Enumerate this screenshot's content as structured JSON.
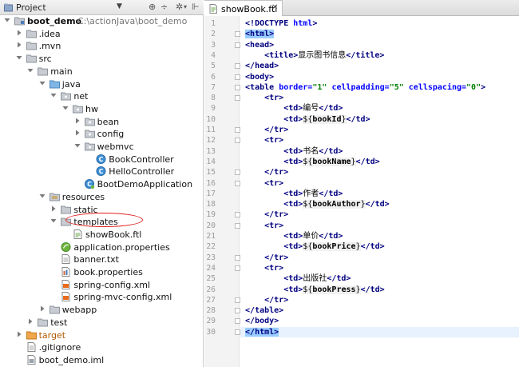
{
  "project_panel": {
    "title": "Project",
    "tree": [
      {
        "label": "boot_demo",
        "path": "C:\\actionJava\\boot_demo",
        "icon": "folder-module-icon",
        "level": 0,
        "expanded": true,
        "bold": true
      },
      {
        "label": ".idea",
        "icon": "folder-icon",
        "level": 1,
        "expanded": false
      },
      {
        "label": ".mvn",
        "icon": "folder-icon",
        "level": 1,
        "expanded": false
      },
      {
        "label": "src",
        "icon": "folder-icon",
        "level": 1,
        "expanded": true
      },
      {
        "label": "main",
        "icon": "folder-icon",
        "level": 2,
        "expanded": true
      },
      {
        "label": "java",
        "icon": "source-folder-icon",
        "level": 3,
        "expanded": true
      },
      {
        "label": "net",
        "icon": "package-icon",
        "level": 4,
        "expanded": true
      },
      {
        "label": "hw",
        "icon": "package-icon",
        "level": 5,
        "expanded": true
      },
      {
        "label": "bean",
        "icon": "package-icon",
        "level": 6,
        "expanded": false
      },
      {
        "label": "config",
        "icon": "package-icon",
        "level": 6,
        "expanded": false
      },
      {
        "label": "webmvc",
        "icon": "package-icon",
        "level": 6,
        "expanded": true
      },
      {
        "label": "BookController",
        "icon": "class-icon",
        "level": 7
      },
      {
        "label": "HelloController",
        "icon": "class-icon",
        "level": 7
      },
      {
        "label": "BootDemoApplication",
        "icon": "spring-boot-class-icon",
        "level": 6
      },
      {
        "label": "resources",
        "icon": "resources-folder-icon",
        "level": 3,
        "expanded": true
      },
      {
        "label": "static",
        "icon": "folder-icon",
        "level": 4,
        "expanded": false
      },
      {
        "label": "templates",
        "icon": "folder-icon",
        "level": 4,
        "expanded": true
      },
      {
        "label": "showBook.ftl",
        "icon": "ftl-file-icon",
        "level": 5
      },
      {
        "label": "application.properties",
        "icon": "spring-properties-icon",
        "level": 4
      },
      {
        "label": "banner.txt",
        "icon": "text-file-icon",
        "level": 4
      },
      {
        "label": "book.properties",
        "icon": "properties-file-icon",
        "level": 4
      },
      {
        "label": "spring-config.xml",
        "icon": "xml-file-icon",
        "level": 4
      },
      {
        "label": "spring-mvc-config.xml",
        "icon": "xml-file-icon",
        "level": 4
      },
      {
        "label": "webapp",
        "icon": "folder-icon",
        "level": 3,
        "expanded": false
      },
      {
        "label": "test",
        "icon": "folder-icon",
        "level": 2,
        "expanded": false
      },
      {
        "label": "target",
        "icon": "excluded-folder-icon",
        "level": 1,
        "expanded": false,
        "target": true
      },
      {
        "label": ".gitignore",
        "icon": "text-file-icon",
        "level": 1
      },
      {
        "label": "boot_demo.iml",
        "icon": "iml-file-icon",
        "level": 1
      }
    ]
  },
  "editor": {
    "tab_label": "showBook.ftl",
    "current_line": 30,
    "lines": [
      [
        {
          "c": "tag",
          "t": "<!DOCTYPE "
        },
        {
          "c": "attr",
          "t": "html"
        },
        {
          "c": "tag",
          "t": ">"
        }
      ],
      [
        {
          "c": "tag tag-hl",
          "t": "<html>"
        }
      ],
      [
        {
          "c": "tag",
          "t": "<head>"
        }
      ],
      [
        {
          "c": "txt",
          "t": "    "
        },
        {
          "c": "tag",
          "t": "<title>"
        },
        {
          "c": "txt",
          "t": "显示图书信息"
        },
        {
          "c": "tag",
          "t": "</title>"
        }
      ],
      [
        {
          "c": "tag",
          "t": "</head>"
        }
      ],
      [
        {
          "c": "tag",
          "t": "<body>"
        }
      ],
      [
        {
          "c": "tag",
          "t": "<table "
        },
        {
          "c": "attr",
          "t": "border="
        },
        {
          "c": "str",
          "t": "\"1\" "
        },
        {
          "c": "attr",
          "t": "cellpadding="
        },
        {
          "c": "str",
          "t": "\"5\" "
        },
        {
          "c": "attr",
          "t": "cellspacing="
        },
        {
          "c": "str",
          "t": "\"0\""
        },
        {
          "c": "tag",
          "t": ">"
        }
      ],
      [
        {
          "c": "txt",
          "t": "    "
        },
        {
          "c": "tag",
          "t": "<tr>"
        }
      ],
      [
        {
          "c": "txt",
          "t": "        "
        },
        {
          "c": "tag",
          "t": "<td>"
        },
        {
          "c": "txt",
          "t": "编号"
        },
        {
          "c": "tag",
          "t": "</td>"
        }
      ],
      [
        {
          "c": "txt",
          "t": "        "
        },
        {
          "c": "tag",
          "t": "<td>"
        },
        {
          "c": "ftl",
          "t": "${"
        },
        {
          "c": "var ftl",
          "t": "bookId"
        },
        {
          "c": "ftl",
          "t": "}"
        },
        {
          "c": "tag",
          "t": "</td>"
        }
      ],
      [
        {
          "c": "txt",
          "t": "    "
        },
        {
          "c": "tag",
          "t": "</tr>"
        }
      ],
      [
        {
          "c": "txt",
          "t": "    "
        },
        {
          "c": "tag",
          "t": "<tr>"
        }
      ],
      [
        {
          "c": "txt",
          "t": "        "
        },
        {
          "c": "tag",
          "t": "<td>"
        },
        {
          "c": "txt",
          "t": "书名"
        },
        {
          "c": "tag",
          "t": "</td>"
        }
      ],
      [
        {
          "c": "txt",
          "t": "        "
        },
        {
          "c": "tag",
          "t": "<td>"
        },
        {
          "c": "ftl",
          "t": "${"
        },
        {
          "c": "var ftl",
          "t": "bookName"
        },
        {
          "c": "ftl",
          "t": "}"
        },
        {
          "c": "tag",
          "t": "</td>"
        }
      ],
      [
        {
          "c": "txt",
          "t": "    "
        },
        {
          "c": "tag",
          "t": "</tr>"
        }
      ],
      [
        {
          "c": "txt",
          "t": "    "
        },
        {
          "c": "tag",
          "t": "<tr>"
        }
      ],
      [
        {
          "c": "txt",
          "t": "        "
        },
        {
          "c": "tag",
          "t": "<td>"
        },
        {
          "c": "txt",
          "t": "作者"
        },
        {
          "c": "tag",
          "t": "</td>"
        }
      ],
      [
        {
          "c": "txt",
          "t": "        "
        },
        {
          "c": "tag",
          "t": "<td>"
        },
        {
          "c": "ftl",
          "t": "${"
        },
        {
          "c": "var ftl",
          "t": "bookAuthor"
        },
        {
          "c": "ftl",
          "t": "}"
        },
        {
          "c": "tag",
          "t": "</td>"
        }
      ],
      [
        {
          "c": "txt",
          "t": "    "
        },
        {
          "c": "tag",
          "t": "</tr>"
        }
      ],
      [
        {
          "c": "txt",
          "t": "    "
        },
        {
          "c": "tag",
          "t": "<tr>"
        }
      ],
      [
        {
          "c": "txt",
          "t": "        "
        },
        {
          "c": "tag",
          "t": "<td>"
        },
        {
          "c": "txt",
          "t": "单价"
        },
        {
          "c": "tag",
          "t": "</td>"
        }
      ],
      [
        {
          "c": "txt",
          "t": "        "
        },
        {
          "c": "tag",
          "t": "<td>"
        },
        {
          "c": "ftl",
          "t": "${"
        },
        {
          "c": "var ftl",
          "t": "bookPrice"
        },
        {
          "c": "ftl",
          "t": "}"
        },
        {
          "c": "tag",
          "t": "</td>"
        }
      ],
      [
        {
          "c": "txt",
          "t": "    "
        },
        {
          "c": "tag",
          "t": "</tr>"
        }
      ],
      [
        {
          "c": "txt",
          "t": "    "
        },
        {
          "c": "tag",
          "t": "<tr>"
        }
      ],
      [
        {
          "c": "txt",
          "t": "        "
        },
        {
          "c": "tag",
          "t": "<td>"
        },
        {
          "c": "txt",
          "t": "出版社"
        },
        {
          "c": "tag",
          "t": "</td>"
        }
      ],
      [
        {
          "c": "txt",
          "t": "        "
        },
        {
          "c": "tag",
          "t": "<td>"
        },
        {
          "c": "ftl",
          "t": "${"
        },
        {
          "c": "var ftl",
          "t": "bookPress"
        },
        {
          "c": "ftl",
          "t": "}"
        },
        {
          "c": "tag",
          "t": "</td>"
        }
      ],
      [
        {
          "c": "txt",
          "t": "    "
        },
        {
          "c": "tag",
          "t": "</tr>"
        }
      ],
      [
        {
          "c": "tag",
          "t": "</table>"
        }
      ],
      [
        {
          "c": "tag",
          "t": "</body>"
        }
      ],
      [
        {
          "c": "tag tag-hl",
          "t": "</html>"
        }
      ]
    ]
  },
  "colors": {
    "selection": "#e8f2fe",
    "tag": "#000080",
    "attr": "#0000ff",
    "string": "#008000",
    "annotation_oval": "#e02020"
  }
}
